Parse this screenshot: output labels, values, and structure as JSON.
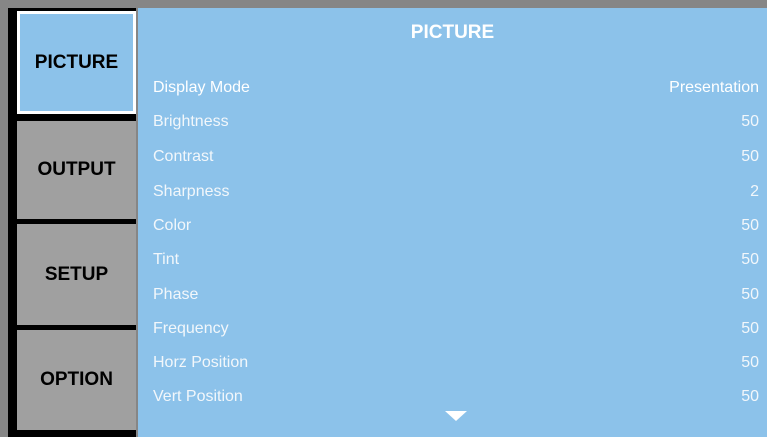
{
  "tabs": [
    {
      "label": "PICTURE",
      "active": true
    },
    {
      "label": "OUTPUT",
      "active": false
    },
    {
      "label": "SETUP",
      "active": false
    },
    {
      "label": "OPTION",
      "active": false
    }
  ],
  "panel": {
    "title": "PICTURE",
    "rows": [
      {
        "label": "Display Mode",
        "value": "Presentation"
      },
      {
        "label": "Brightness",
        "value": "50"
      },
      {
        "label": "Contrast",
        "value": "50"
      },
      {
        "label": "Sharpness",
        "value": "2"
      },
      {
        "label": "Color",
        "value": "50"
      },
      {
        "label": "Tint",
        "value": "50"
      },
      {
        "label": "Phase",
        "value": "50"
      },
      {
        "label": "Frequency",
        "value": "50"
      },
      {
        "label": "Horz Position",
        "value": "50"
      },
      {
        "label": "Vert Position",
        "value": "50"
      }
    ],
    "scroll_icon": "chevron-down-icon"
  },
  "colors": {
    "panel_bg": "#8cc2ea",
    "tab_inactive": "#a0a0a0",
    "frame": "#868686",
    "text_white": "#ffffff"
  }
}
